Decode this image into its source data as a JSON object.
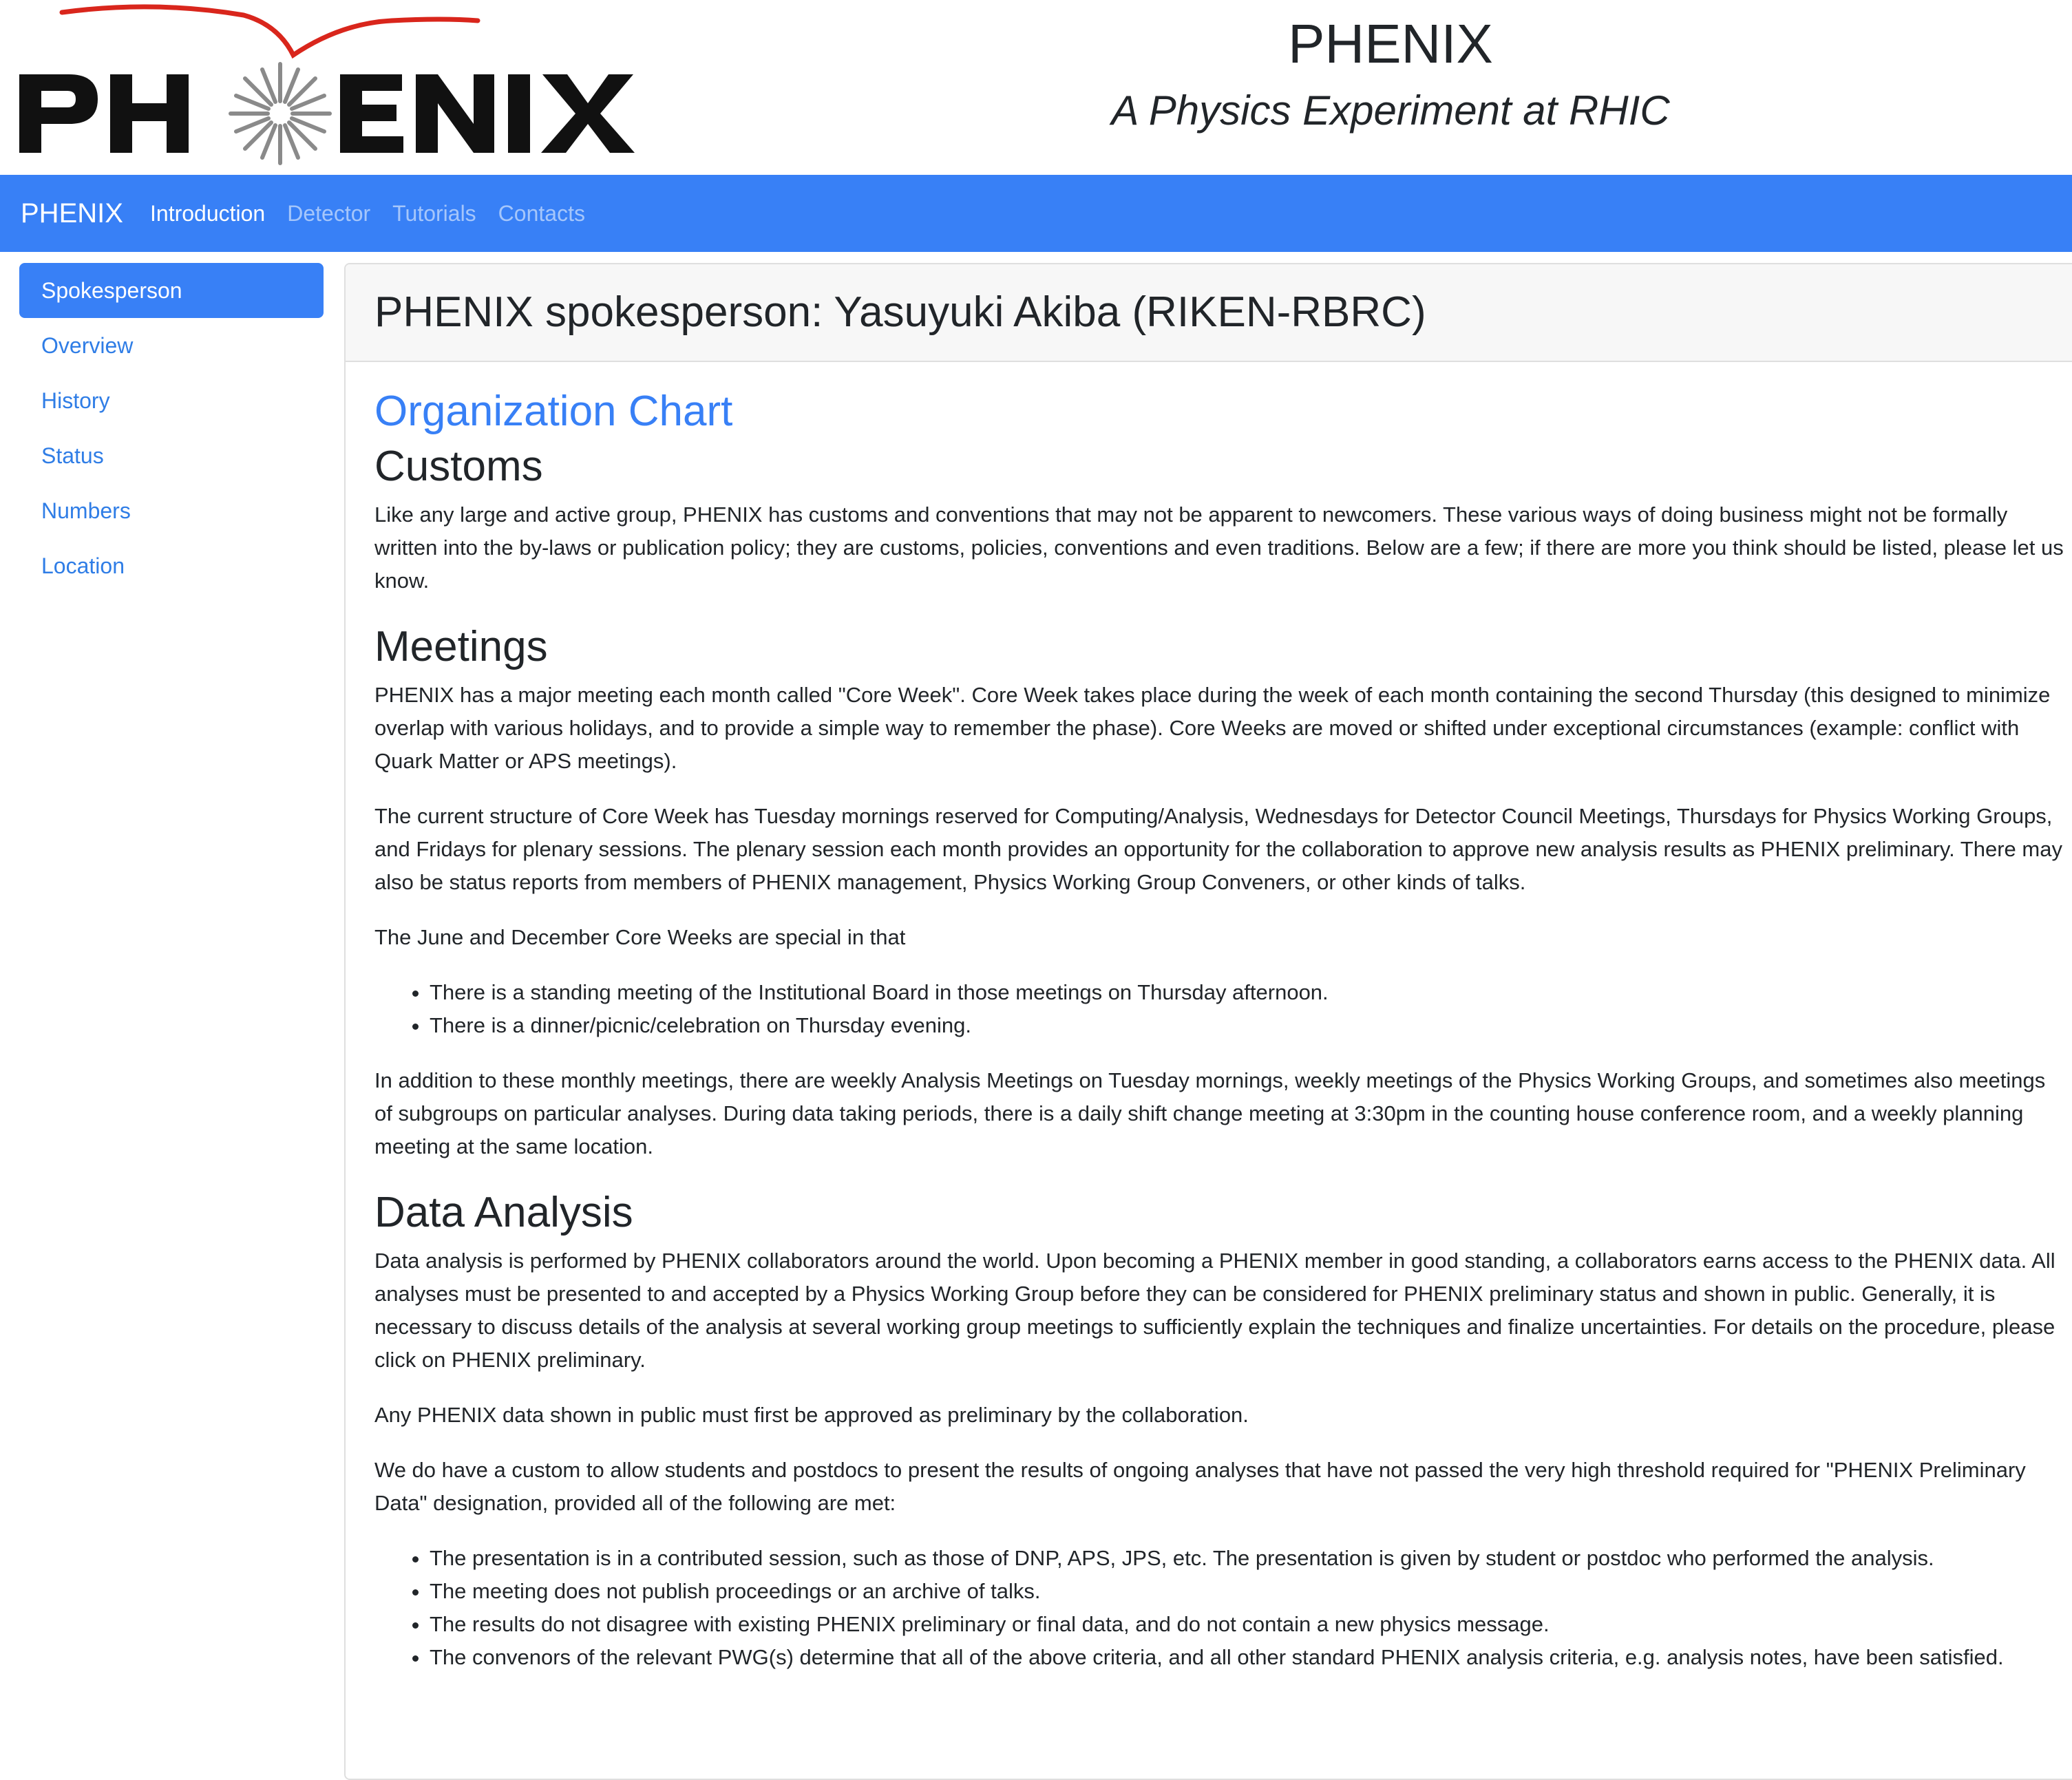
{
  "header": {
    "logo_text": "PHENIX",
    "title": "PHENIX",
    "subtitle": "A Physics Experiment at RHIC"
  },
  "navbar": {
    "brand": "PHENIX",
    "links": [
      {
        "label": "Introduction",
        "active": true
      },
      {
        "label": "Detector",
        "active": false
      },
      {
        "label": "Tutorials",
        "active": false
      },
      {
        "label": "Contacts",
        "active": false
      }
    ]
  },
  "sidebar": {
    "items": [
      {
        "label": "Spokesperson",
        "active": true
      },
      {
        "label": "Overview",
        "active": false
      },
      {
        "label": "History",
        "active": false
      },
      {
        "label": "Status",
        "active": false
      },
      {
        "label": "Numbers",
        "active": false
      },
      {
        "label": "Location",
        "active": false
      }
    ]
  },
  "main": {
    "header": "PHENIX spokesperson: Yasuyuki Akiba (RIKEN-RBRC)",
    "org_chart_link": "Organization Chart",
    "customs": {
      "heading": "Customs",
      "text": "Like any large and active group, PHENIX has customs and conventions that may not be apparent to newcomers. These various ways of doing business might not be formally written into the by-laws or publication policy; they are customs, policies, conventions and even traditions. Below are a few; if there are more you think should be listed, please let us know."
    },
    "meetings": {
      "heading": "Meetings",
      "p1": "PHENIX has a major meeting each month called \"Core Week\". Core Week takes place during the week of each month containing the second Thursday (this designed to minimize overlap with various holidays, and to provide a simple way to remember the phase). Core Weeks are moved or shifted under exceptional circumstances (example: conflict with Quark Matter or APS meetings).",
      "p2": "The current structure of Core Week has Tuesday mornings reserved for Computing/Analysis, Wednesdays for Detector Council Meetings, Thursdays for Physics Working Groups, and Fridays for plenary sessions. The plenary session each month provides an opportunity for the collaboration to approve new analysis results as PHENIX preliminary. There may also be status reports from members of PHENIX management, Physics Working Group Conveners, or other kinds of talks.",
      "p3": "The June and December Core Weeks are special in that",
      "list": [
        "There is a standing meeting of the Institutional Board in those meetings on Thursday afternoon.",
        "There is a dinner/picnic/celebration on Thursday evening."
      ],
      "p4": "In addition to these monthly meetings, there are weekly Analysis Meetings on Tuesday mornings, weekly meetings of the Physics Working Groups, and sometimes also meetings of subgroups on particular analyses. During data taking periods, there is a daily shift change meeting at 3:30pm in the counting house conference room, and a weekly planning meeting at the same location."
    },
    "data_analysis": {
      "heading": "Data Analysis",
      "p1": "Data analysis is performed by PHENIX collaborators around the world. Upon becoming a PHENIX member in good standing, a collaborators earns access to the PHENIX data. All analyses must be presented to and accepted by a Physics Working Group before they can be considered for PHENIX preliminary status and shown in public. Generally, it is necessary to discuss details of the analysis at several working group meetings to sufficiently explain the techniques and finalize uncertainties. For details on the procedure, please click on PHENIX preliminary.",
      "p2": "Any PHENIX data shown in public must first be approved as preliminary by the collaboration.",
      "p3": "We do have a custom to allow students and postdocs to present the results of ongoing analyses that have not passed the very high threshold required for \"PHENIX Preliminary Data\" designation, provided all of the following are met:",
      "list": [
        "The presentation is in a contributed session, such as those of DNP, APS, JPS, etc. The presentation is given by student or postdoc who performed the analysis.",
        "The meeting does not publish proceedings or an archive of talks.",
        "The results do not disagree with existing PHENIX preliminary or final data, and do not contain a new physics message.",
        "The convenors of the relevant PWG(s) determine that all of the above criteria, and all other standard PHENIX analysis criteria, e.g. analysis notes, have been satisfied."
      ]
    }
  },
  "colors": {
    "accent": "#3880f6",
    "link": "#2f7de6",
    "logo_arc": "#d9261c"
  }
}
